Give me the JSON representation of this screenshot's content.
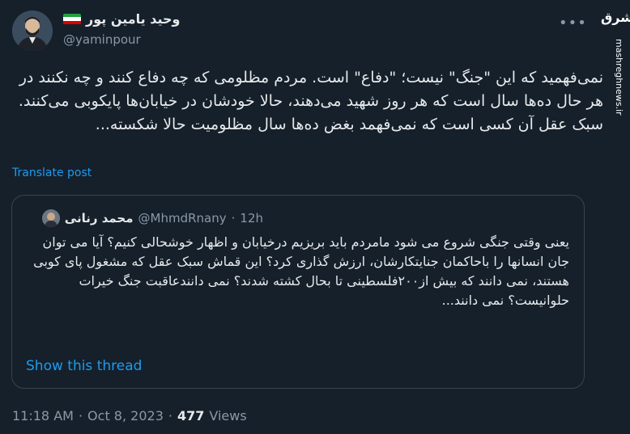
{
  "author": {
    "display_name": "وحید یامین پور",
    "handle": "@yaminpour"
  },
  "tweet": {
    "text": "نمی‌فهمید که این \"جنگ\" نیست؛ \"دفاع\" است. مردم مظلومی که چه دفاع کنند و چه نکنند در هر حال ده‌ها سال است که هر روز شهید می‌دهند، حالا خودشان در خیابان‌ها پایکوبی می‌کنند. سبک عقل آن کسی است که نمی‌فهمد بغض ده‌ها سال مظلومیت حالا شکسته...",
    "translate_label": "Translate post",
    "more_icon": "•••"
  },
  "quote": {
    "display_name": "محمد رنانی",
    "handle": "@MhmdRnany",
    "separator": "·",
    "time": "12h",
    "text": "یعنی وقتی جنگی شروع می شود مامردم باید بریزیم درخیابان و اظهار خوشحالی کنیم؟ آیا می توان جان انسانها را باحاکمان جنایتکارشان، ارزش گذاری کرد؟ این قماش سبک عقل که مشغول پای کوبی هستند، نمی دانند که بیش از۲۰۰فلسطینی تا بحال کشته شدند؟ نمی دانندعاقبت جنگ خیرات حلوانیست؟ نمی دانند...",
    "show_thread_label": "Show this thread"
  },
  "meta": {
    "time": "11:18 AM",
    "separator": "·",
    "date": "Oct 8, 2023",
    "views_count": "477",
    "views_label": "Views"
  },
  "watermark": {
    "logo": "مشرق",
    "site": "mashreghnews.ir"
  }
}
